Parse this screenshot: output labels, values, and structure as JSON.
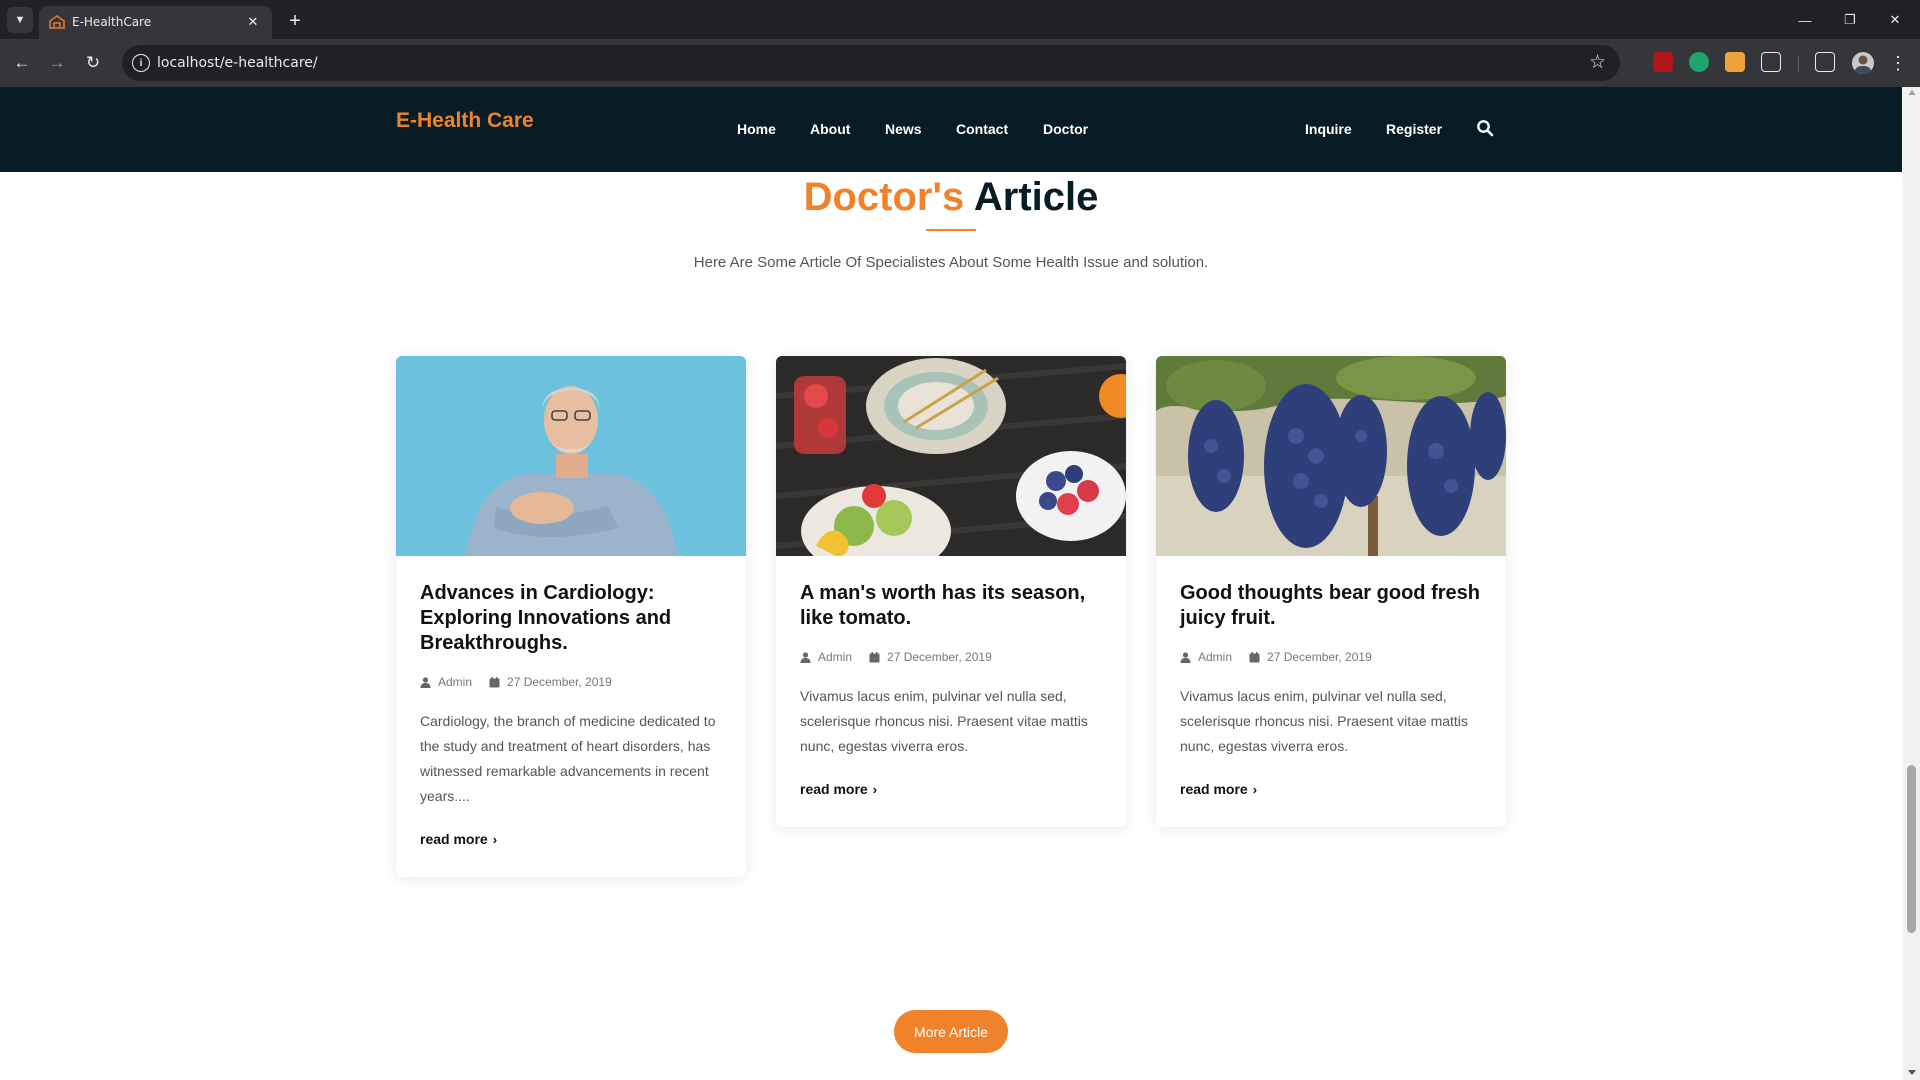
{
  "browser": {
    "tab_title": "E-HealthCare",
    "url": "localhost/e-healthcare/",
    "colors": {
      "frame": "#202124",
      "toolbar": "#35363a"
    }
  },
  "site": {
    "logo": "E-Health Care",
    "nav": [
      "Home",
      "About",
      "News",
      "Contact",
      "Doctor"
    ],
    "nav_right": [
      "Inquire",
      "Register"
    ],
    "colors": {
      "header_bg": "#071c24",
      "accent": "#f0822b"
    }
  },
  "section": {
    "title_accent": "Doctor's",
    "title_rest": "Article",
    "subtitle": "Here Are Some Article Of Specialistes About Some Health Issue and solution."
  },
  "articles": [
    {
      "title": "Advances in Cardiology: Exploring Innovations and Breakthroughs.",
      "author": "Admin",
      "date": "27 December, 2019",
      "excerpt": "Cardiology, the branch of medicine dedicated to the study and treatment of heart disorders, has witnessed remarkable advancements in recent years....",
      "read_more": "read more",
      "image": "man-holding-chest"
    },
    {
      "title": "A man's worth has its season, like tomato.",
      "author": "Admin",
      "date": "27 December, 2019",
      "excerpt": "Vivamus lacus enim, pulvinar vel nulla sed, scelerisque rhoncus nisi. Praesent vitae mattis nunc, egestas viverra eros.",
      "read_more": "read more",
      "image": "fruit-plates"
    },
    {
      "title": "Good thoughts bear good fresh juicy fruit.",
      "author": "Admin",
      "date": "27 December, 2019",
      "excerpt": "Vivamus lacus enim, pulvinar vel nulla sed, scelerisque rhoncus nisi. Praesent vitae mattis nunc, egestas viverra eros.",
      "read_more": "read more",
      "image": "grape-vines"
    }
  ],
  "more_button": "More Article"
}
